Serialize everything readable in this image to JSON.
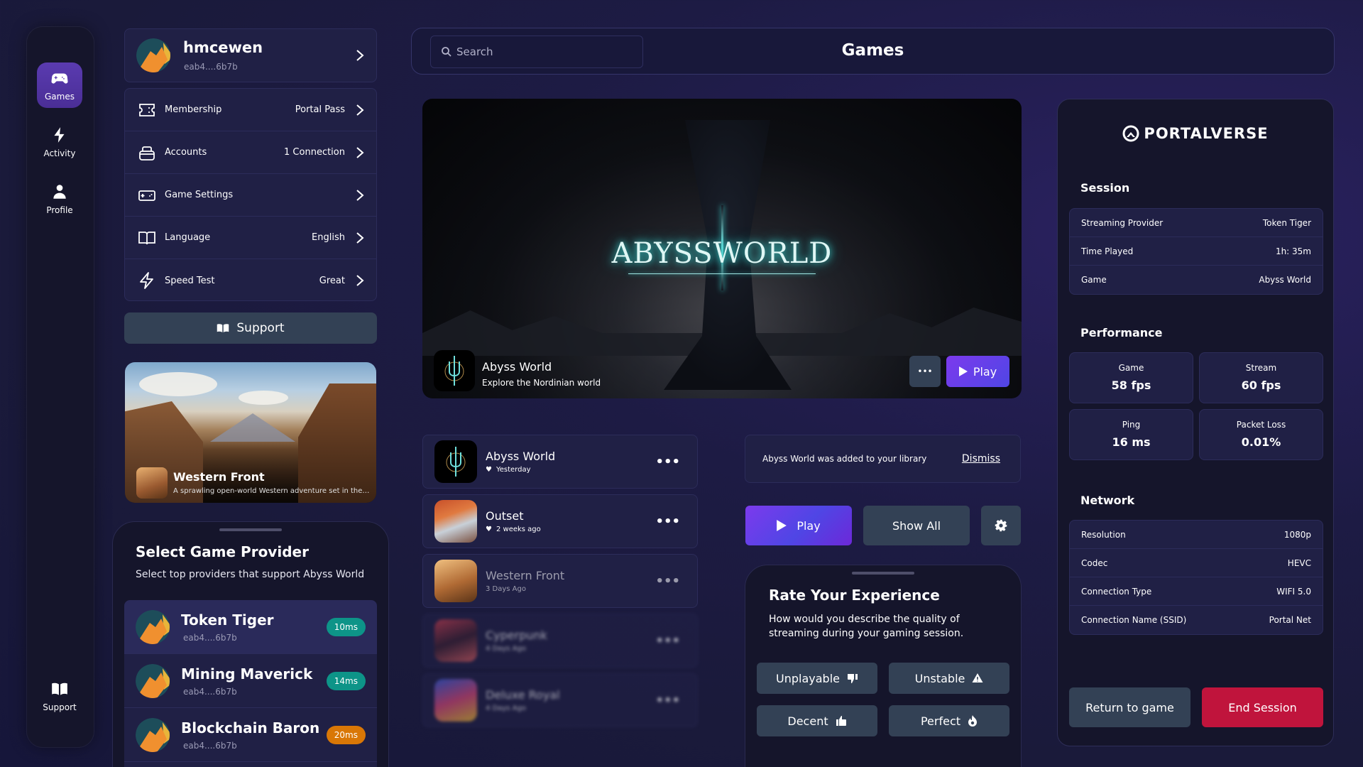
{
  "nav": {
    "items": [
      {
        "label": "Games",
        "icon": "gamepad-icon",
        "active": true
      },
      {
        "label": "Activity",
        "icon": "lightning-icon",
        "active": false
      },
      {
        "label": "Profile",
        "icon": "user-icon",
        "active": false
      }
    ],
    "support_label": "Support"
  },
  "profile": {
    "username": "hmcewen",
    "address": "eab4....6b7b"
  },
  "settings_menu": [
    {
      "label": "Membership",
      "value": "Portal Pass",
      "icon": "ticket-icon"
    },
    {
      "label": "Accounts",
      "value": "1 Connection",
      "icon": "accounts-icon"
    },
    {
      "label": "Game Settings",
      "value": "",
      "icon": "controller-icon"
    },
    {
      "label": "Language",
      "value": "English",
      "icon": "book-icon"
    },
    {
      "label": "Speed Test",
      "value": "Great",
      "icon": "lightning-icon"
    }
  ],
  "support_button": "Support",
  "promo": {
    "title": "Western Front",
    "description": "A sprawling open-world Western adventure set in the l..."
  },
  "provider_sheet": {
    "title": "Select Game Provider",
    "subtitle": "Select top providers that support Abyss World",
    "providers": [
      {
        "name": "Token Tiger",
        "address": "eab4....6b7b",
        "latency": "10ms",
        "color": "#0d9488",
        "selected": true
      },
      {
        "name": "Mining Maverick",
        "address": "eab4....6b7b",
        "latency": "14ms",
        "color": "#0d9488",
        "selected": false
      },
      {
        "name": "Blockchain Baron",
        "address": "eab4....6b7b",
        "latency": "20ms",
        "color": "#d97706",
        "selected": false
      }
    ]
  },
  "header": {
    "search_placeholder": "Search",
    "title": "Games"
  },
  "hero": {
    "logo_text": "ABYSSWORLD",
    "game_name": "Abyss World",
    "tagline": "Explore  the Nordinian world",
    "more_label": "•••",
    "play_label": "Play"
  },
  "recent_games": [
    {
      "name": "Abyss World",
      "when": "Yesterday",
      "favorite": true
    },
    {
      "name": "Outset",
      "when": "2 weeks ago",
      "favorite": true
    },
    {
      "name": "Western Front",
      "when": "3 Days Ago",
      "favorite": false
    },
    {
      "name": "Cyperpunk",
      "when": "4 Days Ago",
      "favorite": false
    },
    {
      "name": "Deluxe Royal",
      "when": "4 Days Ago",
      "favorite": false
    }
  ],
  "more_label": "•••",
  "notification": {
    "message": "Abyss World was added to your library",
    "dismiss": "Dismiss"
  },
  "actions": {
    "play": "Play",
    "show_all": "Show All"
  },
  "rating": {
    "title": "Rate Your Experience",
    "subtitle": "How would you describe the quality of streaming during your gaming session.",
    "options": [
      {
        "label": "Unplayable",
        "icon": "thumbs-down-icon"
      },
      {
        "label": "Unstable",
        "icon": "warning-icon"
      },
      {
        "label": "Decent",
        "icon": "thumbs-up-icon"
      },
      {
        "label": "Perfect",
        "icon": "fire-icon"
      }
    ]
  },
  "session_panel": {
    "brand": "PORTALVERSE",
    "session_title": "Session",
    "session": [
      {
        "label": "Streaming Provider",
        "value": "Token Tiger"
      },
      {
        "label": "Time Played",
        "value": "1h: 35m"
      },
      {
        "label": "Game",
        "value": "Abyss World"
      }
    ],
    "performance_title": "Performance",
    "performance": [
      {
        "label": "Game",
        "value": "58 fps"
      },
      {
        "label": "Stream",
        "value": "60 fps"
      },
      {
        "label": "Ping",
        "value": "16 ms"
      },
      {
        "label": "Packet Loss",
        "value": "0.01%"
      }
    ],
    "network_title": "Network",
    "network": [
      {
        "label": "Resolution",
        "value": "1080p"
      },
      {
        "label": "Codec",
        "value": "HEVC"
      },
      {
        "label": "Connection Type",
        "value": "WIFI 5.0"
      },
      {
        "label": "Connection Name (SSID)",
        "value": "Portal Net"
      }
    ],
    "return_label": "Return to game",
    "end_label": "End Session"
  }
}
